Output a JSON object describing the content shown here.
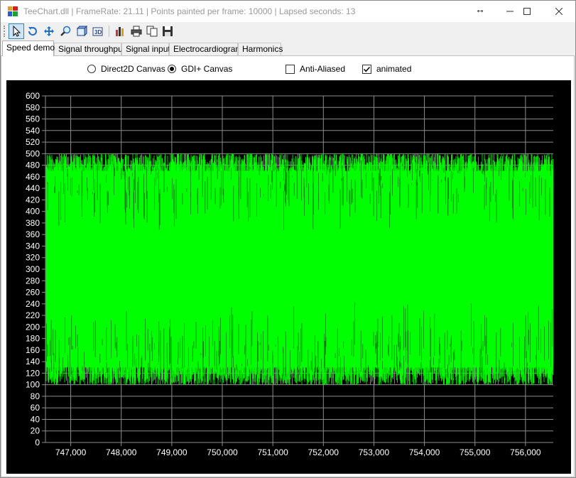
{
  "window": {
    "title": "TeeChart.dll | FrameRate: 21.11 | Points painted per frame: 10000 | Lapsed seconds: 13",
    "resize_glyph": "↔",
    "controls": [
      "minimize",
      "maximize",
      "close"
    ]
  },
  "toolbar": {
    "buttons": [
      {
        "name": "pointer",
        "icon": "arrow-pointer-icon"
      },
      {
        "name": "rotate",
        "icon": "rotate-icon"
      },
      {
        "name": "move",
        "icon": "move-icon"
      },
      {
        "name": "zoom",
        "icon": "magnifier-icon"
      },
      {
        "name": "depth",
        "icon": "depth-icon"
      },
      {
        "name": "3d",
        "icon": "3d-icon"
      },
      {
        "name": "edit",
        "icon": "chart-editor-icon"
      },
      {
        "name": "print",
        "icon": "print-icon"
      },
      {
        "name": "copy",
        "icon": "copy-icon"
      },
      {
        "name": "save",
        "icon": "save-icon"
      }
    ]
  },
  "tabs": [
    "Speed demo",
    "Signal throughput",
    "Signal input",
    "Electrocardiogram",
    "Harmonics"
  ],
  "selected_tab": "Speed demo",
  "options": {
    "direct2d": {
      "label": "Direct2D Canvas",
      "selected": false
    },
    "gdi": {
      "label": "GDI+ Canvas",
      "selected": true
    },
    "antialiased": {
      "label": "Anti-Aliased",
      "checked": false
    },
    "animated": {
      "label": "animated",
      "checked": true
    }
  },
  "colors": {
    "series": "#00ff00",
    "background": "#000000",
    "grid": "#8c8c8c",
    "axis_text": "#ffffff"
  },
  "chart_data": {
    "type": "line",
    "ylim": [
      0,
      600
    ],
    "xlim": [
      746500,
      756550
    ],
    "y_ticks": [
      "0",
      "20",
      "40",
      "60",
      "80",
      "100",
      "120",
      "140",
      "160",
      "180",
      "200",
      "220",
      "240",
      "260",
      "280",
      "300",
      "320",
      "340",
      "360",
      "380",
      "400",
      "420",
      "440",
      "460",
      "480",
      "500",
      "520",
      "540",
      "560",
      "580",
      "600"
    ],
    "x_ticks": [
      "747,000",
      "748,000",
      "749,000",
      "750,000",
      "751,000",
      "752,000",
      "753,000",
      "754,000",
      "755,000",
      "756,000"
    ],
    "series_band": {
      "core_low": 130,
      "core_high": 470,
      "min": 100,
      "max": 500
    },
    "grid": true,
    "legend": "none"
  }
}
